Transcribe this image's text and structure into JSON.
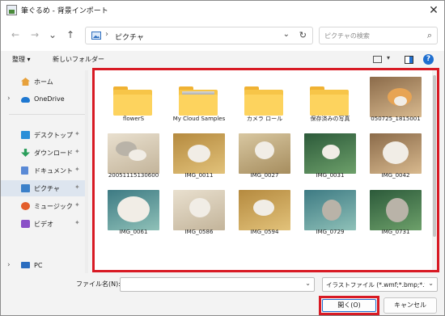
{
  "window": {
    "title": "筆ぐるめ - 背景インポート",
    "close": "✕"
  },
  "nav": {
    "back": "←",
    "forward": "→",
    "recent": "⌄",
    "up": "↑",
    "address_sep": "›",
    "breadcrumb": "ピクチャ",
    "address_dropdown": "⌄",
    "refresh": "↻",
    "search_placeholder": "ピクチャの検索",
    "search_icon": "⌕"
  },
  "toolbar": {
    "organize_label": "整理 ▾",
    "new_folder_label": "新しいフォルダー",
    "view_dropdown": "▾",
    "help": "?"
  },
  "sidebar": {
    "items": [
      {
        "label": "ホーム",
        "icon": "home-icon",
        "chevron": "",
        "pinned": false,
        "selected": false
      },
      {
        "label": "OneDrive",
        "icon": "cloud-icon",
        "chevron": "›",
        "pinned": false,
        "selected": false
      },
      {
        "label": "デスクトップ",
        "icon": "desktop-icon",
        "chevron": "",
        "pinned": true,
        "selected": false
      },
      {
        "label": "ダウンロード",
        "icon": "download-icon",
        "chevron": "",
        "pinned": true,
        "selected": false
      },
      {
        "label": "ドキュメント",
        "icon": "document-icon",
        "chevron": "",
        "pinned": true,
        "selected": false
      },
      {
        "label": "ピクチャ",
        "icon": "pictures-icon",
        "chevron": "",
        "pinned": true,
        "selected": true
      },
      {
        "label": "ミュージック",
        "icon": "music-icon",
        "chevron": "",
        "pinned": true,
        "selected": false
      },
      {
        "label": "ビデオ",
        "icon": "video-icon",
        "chevron": "",
        "pinned": true,
        "selected": false
      },
      {
        "label": "PC",
        "icon": "pc-icon",
        "chevron": "›",
        "pinned": false,
        "selected": false
      }
    ],
    "pin_glyph": "✦"
  },
  "files": [
    {
      "name": "flowerS",
      "kind": "folder"
    },
    {
      "name": "My Cloud Samples",
      "kind": "folder-photo"
    },
    {
      "name": "カメラ ロール",
      "kind": "folder"
    },
    {
      "name": "保存済みの写真",
      "kind": "folder"
    },
    {
      "name": "050725_1815001",
      "kind": "photo"
    },
    {
      "name": "20051115130600",
      "kind": "photo"
    },
    {
      "name": "IMG_0011",
      "kind": "photo"
    },
    {
      "name": "IMG_0027",
      "kind": "photo"
    },
    {
      "name": "IMG_0031",
      "kind": "photo"
    },
    {
      "name": "IMG_0042",
      "kind": "photo"
    },
    {
      "name": "IMG_0061",
      "kind": "photo"
    },
    {
      "name": "IMG_0586",
      "kind": "photo"
    },
    {
      "name": "IMG_0594",
      "kind": "photo"
    },
    {
      "name": "IMG_0729",
      "kind": "photo"
    },
    {
      "name": "IMG_0731",
      "kind": "photo"
    }
  ],
  "bottom": {
    "filename_label": "ファイル名(N):",
    "filename_value": "",
    "filetype_value": "イラストファイル (*.wmf;*.bmp;*.tif",
    "dropdown": "⌄",
    "open_label": "開く(O)",
    "cancel_label": "キャンセル"
  },
  "colors": {
    "highlight_border": "#d81a24",
    "accent": "#1f6fd0",
    "folder": "#f7c548"
  }
}
